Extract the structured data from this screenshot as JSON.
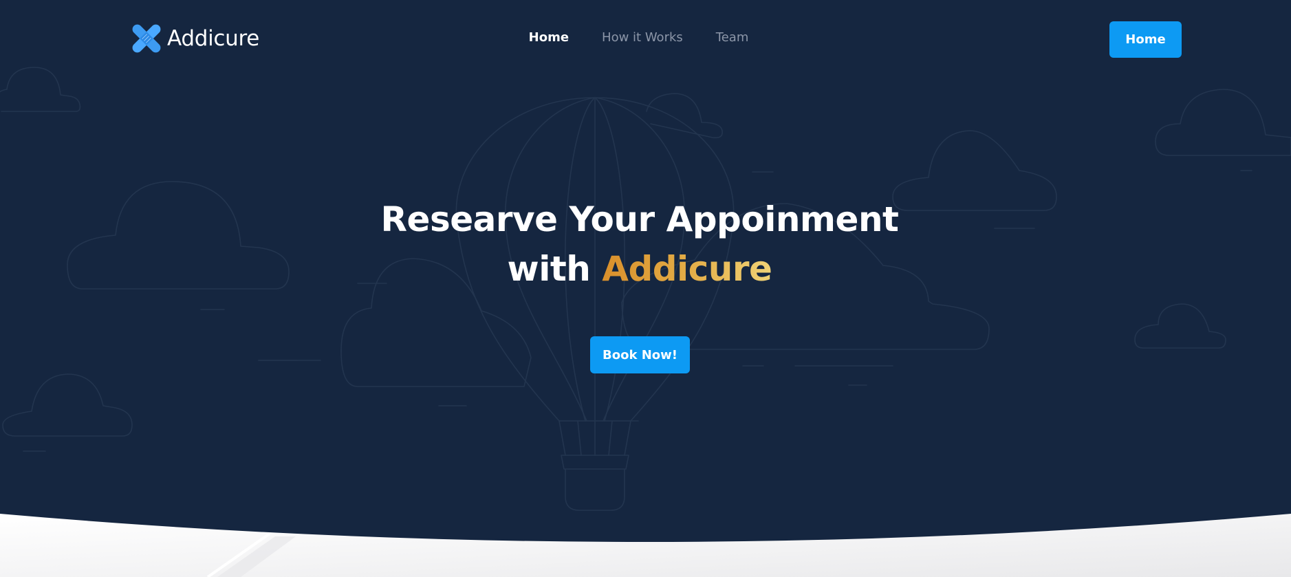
{
  "brand": {
    "name": "Addicure",
    "icon": "bandage-x-icon",
    "icon_color": "#4aa8ff"
  },
  "nav": {
    "links": [
      {
        "label": "Home",
        "active": true
      },
      {
        "label": "How it Works",
        "active": false
      },
      {
        "label": "Team",
        "active": false
      }
    ],
    "cta_label": "Home"
  },
  "hero": {
    "headline_line1": "Researve Your Appoinment",
    "headline_line2_prefix": "with",
    "headline_line2_highlight": "Addicure",
    "cta_label": "Book Now!"
  },
  "colors": {
    "background": "#152640",
    "primary": "#0d9af3",
    "highlight_gradient_start": "#d98f2b",
    "highlight_gradient_end": "#f0d276",
    "nav_inactive": "#8c96a8",
    "outline_art": "#23354f",
    "footer_background": "#f2f2f3"
  },
  "background_art": {
    "icons": [
      "hot-air-balloon-icon",
      "cloud-icon"
    ]
  }
}
